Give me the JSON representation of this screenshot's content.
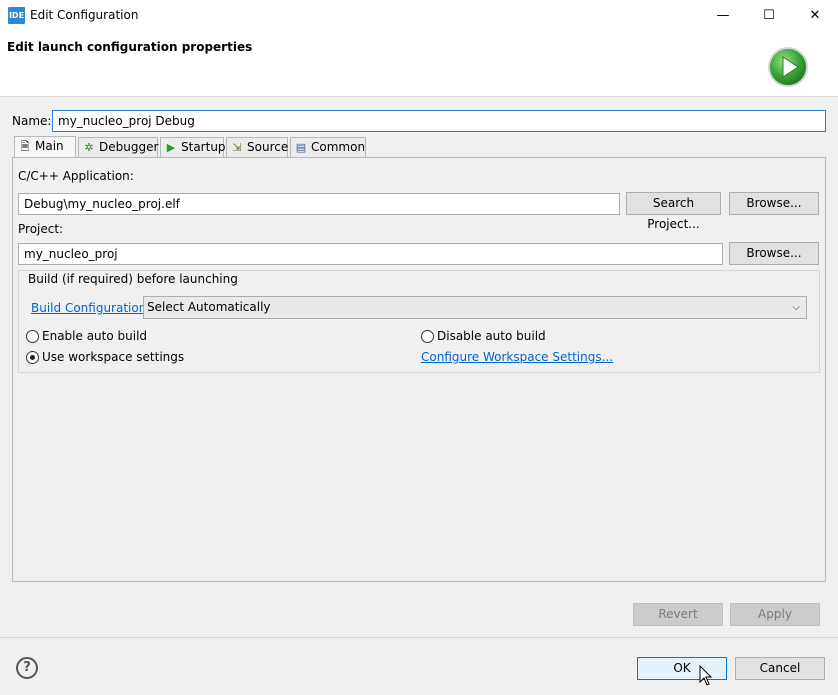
{
  "window": {
    "app_icon_text": "IDE",
    "title": "Edit Configuration",
    "minimize_glyph": "—",
    "maximize_glyph": "☐",
    "close_glyph": "✕"
  },
  "header": {
    "title": "Edit launch configuration properties",
    "icon": "run-play-icon"
  },
  "name_field": {
    "label": "Name:",
    "value": "my_nucleo_proj Debug"
  },
  "tabs": [
    {
      "label": "Main",
      "icon": "document-icon",
      "active": true
    },
    {
      "label": "Debugger",
      "icon": "bug-icon",
      "active": false
    },
    {
      "label": "Startup",
      "icon": "play-icon",
      "active": false
    },
    {
      "label": "Source",
      "icon": "source-icon",
      "active": false
    },
    {
      "label": "Common",
      "icon": "table-icon",
      "active": false
    }
  ],
  "main": {
    "app_label": "C/C++ Application:",
    "app_value": "Debug\\my_nucleo_proj.elf",
    "search_project_label": "Search Project...",
    "browse_label": "Browse...",
    "project_label": "Project:",
    "project_value": "my_nucleo_proj",
    "project_browse_label": "Browse..."
  },
  "build": {
    "group_title": "Build (if required) before launching",
    "config_link": "Build Configuration:",
    "config_value": "Select Automatically",
    "enable_auto_build": "Enable auto build",
    "disable_auto_build": "Disable auto build",
    "use_workspace_settings": "Use workspace settings",
    "configure_workspace_link": "Configure Workspace Settings...",
    "selected": "use_workspace_settings"
  },
  "footer": {
    "revert_label": "Revert",
    "apply_label": "Apply",
    "ok_label": "OK",
    "cancel_label": "Cancel",
    "help_glyph": "?"
  },
  "colors": {
    "link": "#0066cc",
    "focus_border": "#2c7fd3",
    "run_icon_green": "#3aa53a"
  }
}
